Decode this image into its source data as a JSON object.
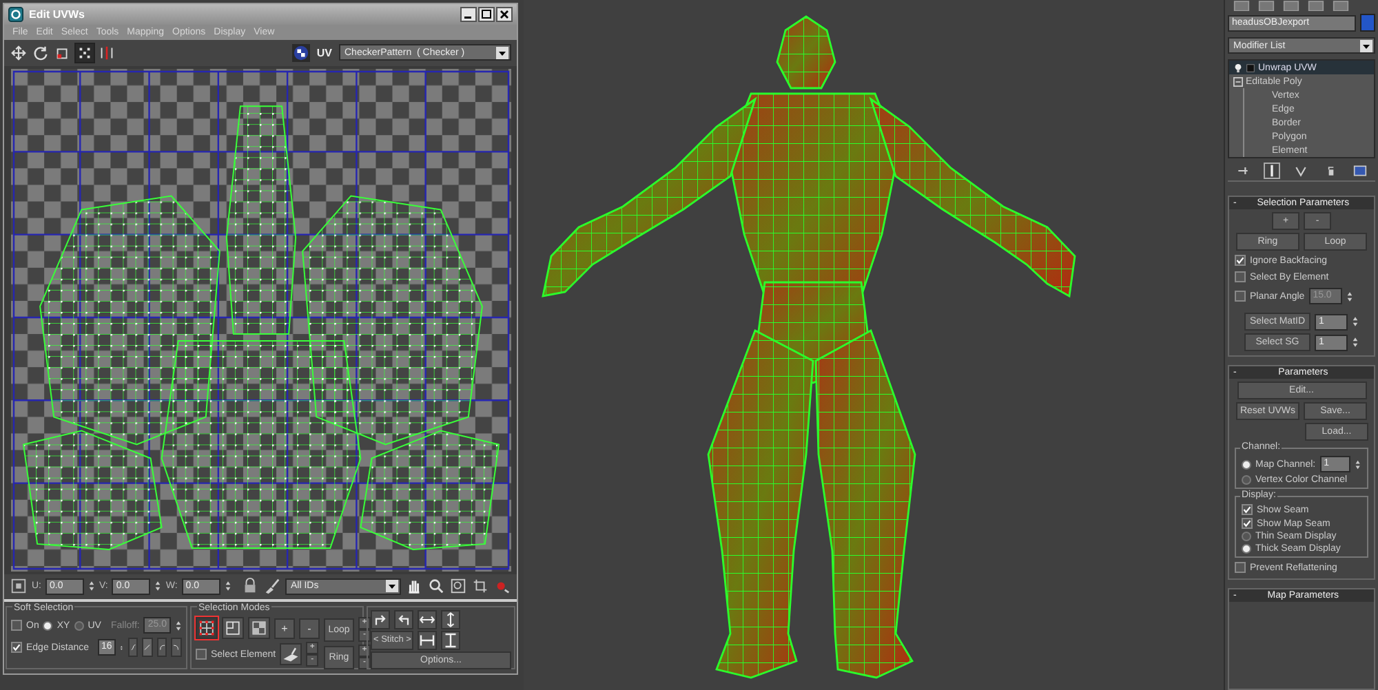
{
  "uv_editor": {
    "title": "Edit UVWs",
    "menu": [
      {
        "label": "File"
      },
      {
        "label": "Edit"
      },
      {
        "label": "Select"
      },
      {
        "label": "Tools"
      },
      {
        "label": "Mapping"
      },
      {
        "label": "Options"
      },
      {
        "label": "Display"
      },
      {
        "label": "View"
      }
    ],
    "tools": [
      {
        "selected": false
      },
      {
        "selected": false
      },
      {
        "selected": false
      },
      {
        "selected": true
      },
      {
        "selected": false
      }
    ],
    "uv_label": "UV",
    "texture": "CheckerPattern  ( Checker )",
    "coords": [
      {
        "label": "U:",
        "value": "0.0"
      },
      {
        "label": "V:",
        "value": "0.0"
      },
      {
        "label": "W:",
        "value": "0.0"
      }
    ],
    "ids": "All IDs",
    "soft_selection": {
      "title": "Soft Selection",
      "on": {
        "label": "On",
        "checked": false
      },
      "spaces": [
        {
          "label": "XY",
          "selected": true
        },
        {
          "label": "UV",
          "selected": false
        }
      ],
      "falloff_label": "Falloff:",
      "falloff": "25.0",
      "edge_distance": {
        "label": "Edge Distance",
        "checked": true
      },
      "distance": "16",
      "curves": [
        {
          "selected": false
        },
        {
          "selected": true
        },
        {
          "selected": false
        },
        {
          "selected": false
        }
      ]
    },
    "selection_modes": {
      "title": "Selection Modes",
      "modes": [
        {
          "selected": true
        },
        {
          "selected": false
        },
        {
          "selected": false
        }
      ],
      "grow": "+",
      "shrink": "-",
      "select_element": {
        "label": "Select Element",
        "checked": false
      },
      "paint_steps": {
        "plus": "+",
        "minus": "-"
      },
      "loop": "Loop",
      "loop_steps": {
        "plus": "+",
        "minus": "-"
      },
      "ring": "Ring",
      "ring_steps": {
        "plus": "+",
        "minus": "-"
      }
    },
    "stitch": {
      "left": "<",
      "label": "Stitch",
      "right": ">"
    },
    "options": "Options..."
  },
  "command_panel": {
    "object_name": "headusOBJexport",
    "modifier_list": "Modifier List",
    "stack": [
      {
        "kind": "modifier",
        "label": "Unwrap UVW",
        "selected": true
      },
      {
        "kind": "base",
        "label": "Editable Poly",
        "selected": false,
        "expanded": true,
        "children": [
          {
            "label": "Vertex"
          },
          {
            "label": "Edge"
          },
          {
            "label": "Border"
          },
          {
            "label": "Polygon"
          },
          {
            "label": "Element"
          }
        ]
      }
    ],
    "selection_parameters": {
      "toggle": "-",
      "title": "Selection Parameters",
      "grow": "+",
      "shrink": "-",
      "ring": "Ring",
      "loop": "Loop",
      "options": [
        {
          "label": "Ignore Backfacing",
          "checked": true
        },
        {
          "label": "Select By Element",
          "checked": false
        },
        {
          "label": "Planar Angle",
          "checked": false,
          "value": "15.0"
        }
      ],
      "select_matid": {
        "label": "Select MatID",
        "value": "1"
      },
      "select_sg": {
        "label": "Select SG",
        "value": "1"
      }
    },
    "parameters": {
      "toggle": "-",
      "title": "Parameters",
      "edit": "Edit...",
      "reset": "Reset UVWs",
      "save": "Save...",
      "load": "Load...",
      "channel": {
        "title": "Channel:",
        "options": [
          {
            "label": "Map Channel:",
            "selected": true,
            "value": "1"
          },
          {
            "label": "Vertex Color Channel",
            "selected": false
          }
        ]
      },
      "display": {
        "title": "Display:",
        "seams": [
          {
            "label": "Show Seam",
            "checked": true
          },
          {
            "label": "Show Map Seam",
            "checked": true
          }
        ],
        "styles": [
          {
            "label": "Thin Seam Display",
            "selected": false
          },
          {
            "label": "Thick Seam Display",
            "selected": true
          }
        ]
      },
      "prevent_reflattening": {
        "label": "Prevent Reflattening",
        "checked": false
      }
    },
    "map_parameters": {
      "toggle": "-",
      "title": "Map Parameters"
    }
  }
}
